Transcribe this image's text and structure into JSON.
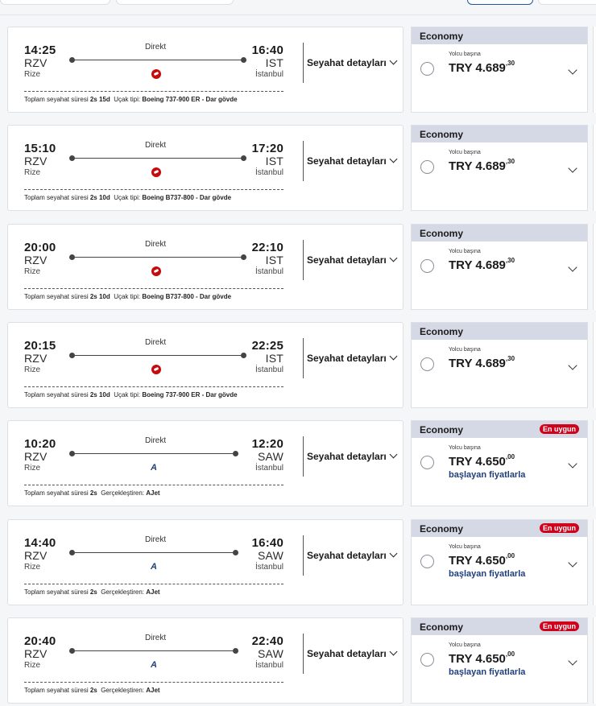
{
  "labels": {
    "direct": "Direkt",
    "details": "Seyahat detayları",
    "per_passenger": "Yolcu başına",
    "total_travel": "Toplam seyahat süresi",
    "aircraft": "Uçak tipi:",
    "operated": "Gerçekleştiren:",
    "cheapest": "En uygun",
    "from_price": "başlayan fiyatlarla"
  },
  "flights": [
    {
      "dep_time": "14:25",
      "dep_code": "RZV",
      "dep_city": "Rize",
      "arr_time": "16:40",
      "arr_code": "IST",
      "arr_city": "İstanbul",
      "airline_icon": "turkish-airlines-logo",
      "duration": "2s 15d",
      "footer_label": "Uçak tipi:",
      "footer_value": "Boeing 737-900 ER - Dar gövde",
      "cabin": "Economy",
      "badge": "",
      "currency": "TRY",
      "price_main": "4.689",
      "price_cents": ",30",
      "from_text": ""
    },
    {
      "dep_time": "15:10",
      "dep_code": "RZV",
      "dep_city": "Rize",
      "arr_time": "17:20",
      "arr_code": "IST",
      "arr_city": "İstanbul",
      "airline_icon": "turkish-airlines-logo",
      "duration": "2s 10d",
      "footer_label": "Uçak tipi:",
      "footer_value": "Boeing B737-800 - Dar gövde",
      "cabin": "Economy",
      "badge": "",
      "currency": "TRY",
      "price_main": "4.689",
      "price_cents": ",30",
      "from_text": ""
    },
    {
      "dep_time": "20:00",
      "dep_code": "RZV",
      "dep_city": "Rize",
      "arr_time": "22:10",
      "arr_code": "IST",
      "arr_city": "İstanbul",
      "airline_icon": "turkish-airlines-logo",
      "duration": "2s 10d",
      "footer_label": "Uçak tipi:",
      "footer_value": "Boeing B737-800 - Dar gövde",
      "cabin": "Economy",
      "badge": "",
      "currency": "TRY",
      "price_main": "4.689",
      "price_cents": ",30",
      "from_text": ""
    },
    {
      "dep_time": "20:15",
      "dep_code": "RZV",
      "dep_city": "Rize",
      "arr_time": "22:25",
      "arr_code": "IST",
      "arr_city": "İstanbul",
      "airline_icon": "turkish-airlines-logo",
      "duration": "2s 10d",
      "footer_label": "Uçak tipi:",
      "footer_value": "Boeing 737-900 ER - Dar gövde",
      "cabin": "Economy",
      "badge": "",
      "currency": "TRY",
      "price_main": "4.689",
      "price_cents": ",30",
      "from_text": ""
    },
    {
      "dep_time": "10:20",
      "dep_code": "RZV",
      "dep_city": "Rize",
      "arr_time": "12:20",
      "arr_code": "SAW",
      "arr_city": "İstanbul",
      "airline_icon": "ajet-logo",
      "duration": "2s",
      "footer_label": "Gerçekleştiren:",
      "footer_value": "AJet",
      "cabin": "Economy",
      "badge": "En uygun",
      "currency": "TRY",
      "price_main": "4.650",
      "price_cents": ",00",
      "from_text": "başlayan fiyatlarla"
    },
    {
      "dep_time": "14:40",
      "dep_code": "RZV",
      "dep_city": "Rize",
      "arr_time": "16:40",
      "arr_code": "SAW",
      "arr_city": "İstanbul",
      "airline_icon": "ajet-logo",
      "duration": "2s",
      "footer_label": "Gerçekleştiren:",
      "footer_value": "AJet",
      "cabin": "Economy",
      "badge": "En uygun",
      "currency": "TRY",
      "price_main": "4.650",
      "price_cents": ",00",
      "from_text": "başlayan fiyatlarla"
    },
    {
      "dep_time": "20:40",
      "dep_code": "RZV",
      "dep_city": "Rize",
      "arr_time": "22:40",
      "arr_code": "SAW",
      "arr_city": "İstanbul",
      "airline_icon": "ajet-logo",
      "duration": "2s",
      "footer_label": "Gerçekleştiren:",
      "footer_value": "AJet",
      "cabin": "Economy",
      "badge": "En uygun",
      "currency": "TRY",
      "price_main": "4.650",
      "price_cents": ",00",
      "from_text": "başlayan fiyatlarla"
    }
  ]
}
